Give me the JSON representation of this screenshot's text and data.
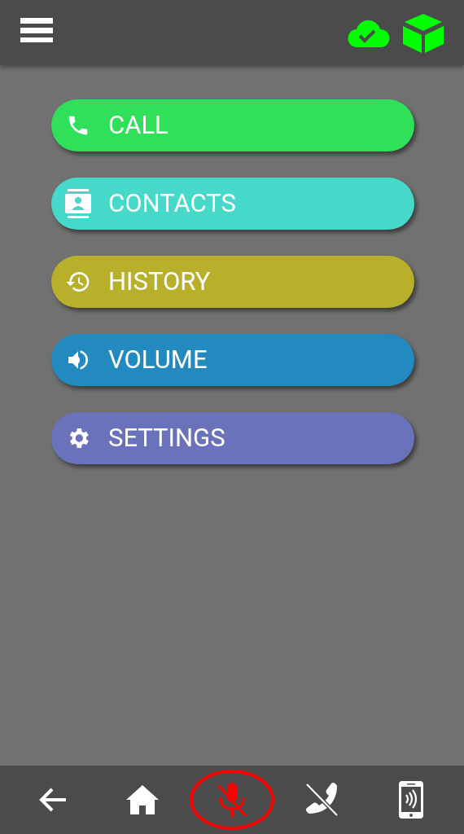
{
  "menu": [
    {
      "label": "CALL",
      "kind": "call",
      "color": "#30e058"
    },
    {
      "label": "CONTACTS",
      "kind": "contacts",
      "color": "#46d8c8"
    },
    {
      "label": "HISTORY",
      "kind": "history",
      "color": "#b8b02a"
    },
    {
      "label": "VOLUME",
      "kind": "volume",
      "color": "#238abf"
    },
    {
      "label": "SETTINGS",
      "kind": "settings",
      "color": "#6b72bc"
    }
  ],
  "bottom_bar": [
    {
      "kind": "back",
      "selected": false
    },
    {
      "kind": "home",
      "selected": false
    },
    {
      "kind": "mic",
      "selected": true
    },
    {
      "kind": "hangup",
      "selected": false
    },
    {
      "kind": "phone",
      "selected": false
    }
  ]
}
